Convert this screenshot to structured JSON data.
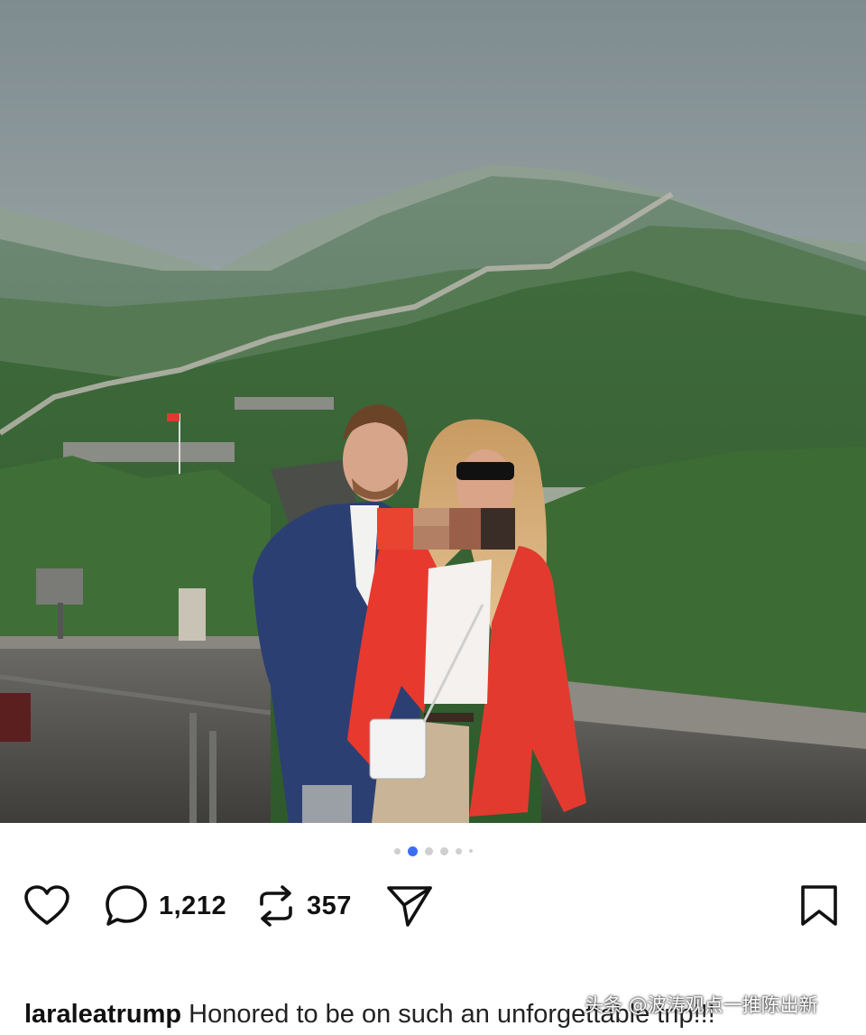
{
  "post": {
    "photo_alt": "Two people posing on the Great Wall",
    "carousel": {
      "total": 6,
      "active_index": 1
    },
    "actions": {
      "like_icon": "heart-icon",
      "comment_icon": "comment-icon",
      "comment_count": "1,212",
      "repost_icon": "repost-icon",
      "repost_count": "357",
      "share_icon": "send-icon",
      "save_icon": "bookmark-icon"
    },
    "caption": {
      "username": "laraleatrump",
      "text": "Honored to be on such an unforgettable trip!!!"
    }
  },
  "watermark": "头条 @波涛观点一推陈出新",
  "colors": {
    "accent": "#3b6ef5",
    "blazer_red": "#e63a30",
    "text": "#111111"
  }
}
